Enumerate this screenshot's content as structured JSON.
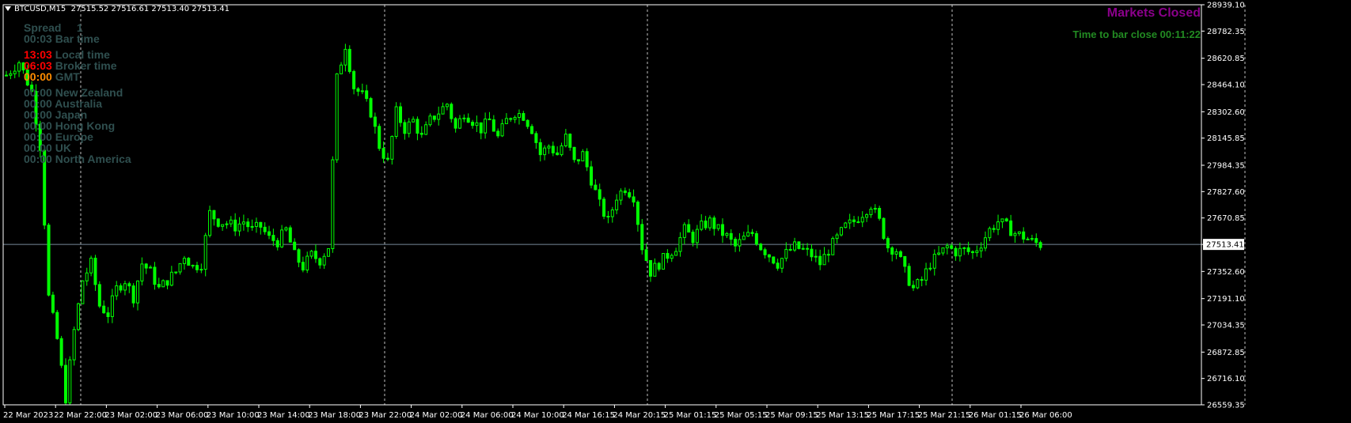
{
  "header": {
    "symbol": "BTCUSD,M15",
    "ohlc": "27515.52 27516.61 27513.40 27513.41"
  },
  "status": {
    "markets": "Markets Closed",
    "bar_close": "Time to bar close 00:11:22"
  },
  "info_panel": {
    "spread_label": "Spread",
    "spread_value": "1",
    "bar_time_value": "00:03",
    "bar_time_label": "Bar time",
    "local_time_value": "13:03",
    "local_time_label": "Local time",
    "broker_time_value": "06:03",
    "broker_time_label": "Broker time",
    "gmt_value": "00:00",
    "gmt_label": "GMT",
    "sessions": [
      {
        "time": "00:00",
        "name": "New Zealand"
      },
      {
        "time": "00:00",
        "name": "Australia"
      },
      {
        "time": "00:00",
        "name": "Japan"
      },
      {
        "time": "00:00",
        "name": "Hong Kong"
      },
      {
        "time": "00:00",
        "name": "Europe"
      },
      {
        "time": "00:00",
        "name": "UK"
      },
      {
        "time": "00:00",
        "name": "North America"
      }
    ]
  },
  "colors": {
    "background": "#000000",
    "candles": "#00ff00",
    "grid_separator": "#c0c0c0",
    "bid_line": "#778899",
    "panel_text": "#2f4f4f",
    "local_time": "#ff0000",
    "broker_time": "#ff0000",
    "gmt": "#ff8c00",
    "markets_closed": "#8b008b",
    "bar_close": "#228b22"
  },
  "chart_data": {
    "type": "candlestick",
    "symbol": "BTCUSD",
    "timeframe": "M15",
    "current_price": 27513.41,
    "ylim": [
      26559.35,
      28939.1
    ],
    "y_ticks": [
      "28939.10",
      "28782.35",
      "28620.85",
      "28464.10",
      "28302.60",
      "28145.85",
      "27984.35",
      "27827.60",
      "27670.85",
      "27513.41",
      "27352.60",
      "27191.10",
      "27034.35",
      "26872.85",
      "26716.10",
      "26559.35"
    ],
    "x_ticks": [
      "22 Mar 2023",
      "22 Mar 22:00",
      "23 Mar 02:00",
      "23 Mar 06:00",
      "23 Mar 10:00",
      "23 Mar 14:00",
      "23 Mar 18:00",
      "23 Mar 22:00",
      "24 Mar 02:00",
      "24 Mar 06:00",
      "24 Mar 10:00",
      "24 Mar 16:15",
      "24 Mar 20:15",
      "25 Mar 01:15",
      "25 Mar 05:15",
      "25 Mar 09:15",
      "25 Mar 13:15",
      "25 Mar 17:15",
      "25 Mar 21:15",
      "26 Mar 01:15",
      "26 Mar 06:00"
    ],
    "day_separators_at_ticks": [
      1,
      7,
      12,
      18
    ],
    "close_path": [
      [
        0,
        28520
      ],
      [
        3,
        28600
      ],
      [
        6,
        28420
      ],
      [
        8,
        28100
      ],
      [
        10,
        27200
      ],
      [
        12,
        26950
      ],
      [
        14,
        26600
      ],
      [
        16,
        27000
      ],
      [
        18,
        27300
      ],
      [
        20,
        27400
      ],
      [
        22,
        27150
      ],
      [
        24,
        27100
      ],
      [
        26,
        27250
      ],
      [
        28,
        27300
      ],
      [
        30,
        27200
      ],
      [
        32,
        27400
      ],
      [
        34,
        27350
      ],
      [
        36,
        27250
      ],
      [
        38,
        27300
      ],
      [
        40,
        27350
      ],
      [
        42,
        27450
      ],
      [
        44,
        27380
      ],
      [
        46,
        27400
      ],
      [
        48,
        27700
      ],
      [
        50,
        27650
      ],
      [
        52,
        27640
      ],
      [
        54,
        27620
      ],
      [
        56,
        27650
      ],
      [
        58,
        27600
      ],
      [
        60,
        27620
      ],
      [
        62,
        27550
      ],
      [
        64,
        27530
      ],
      [
        66,
        27600
      ],
      [
        68,
        27450
      ],
      [
        70,
        27380
      ],
      [
        72,
        27450
      ],
      [
        74,
        27420
      ],
      [
        76,
        27500
      ],
      [
        78,
        28500
      ],
      [
        80,
        28700
      ],
      [
        82,
        28450
      ],
      [
        84,
        28400
      ],
      [
        86,
        28300
      ],
      [
        88,
        28100
      ],
      [
        90,
        28000
      ],
      [
        92,
        28300
      ],
      [
        94,
        28200
      ],
      [
        96,
        28250
      ],
      [
        98,
        28150
      ],
      [
        100,
        28250
      ],
      [
        102,
        28300
      ],
      [
        104,
        28350
      ],
      [
        106,
        28200
      ],
      [
        108,
        28300
      ],
      [
        110,
        28250
      ],
      [
        112,
        28200
      ],
      [
        114,
        28250
      ],
      [
        116,
        28150
      ],
      [
        118,
        28250
      ],
      [
        120,
        28300
      ],
      [
        122,
        28280
      ],
      [
        124,
        28200
      ],
      [
        126,
        28050
      ],
      [
        128,
        28100
      ],
      [
        130,
        28050
      ],
      [
        132,
        28150
      ],
      [
        134,
        28000
      ],
      [
        136,
        28050
      ],
      [
        138,
        27900
      ],
      [
        140,
        27750
      ],
      [
        142,
        27650
      ],
      [
        144,
        27800
      ],
      [
        146,
        27850
      ],
      [
        148,
        27800
      ],
      [
        150,
        27500
      ],
      [
        152,
        27350
      ],
      [
        154,
        27400
      ],
      [
        156,
        27450
      ],
      [
        158,
        27500
      ],
      [
        160,
        27600
      ],
      [
        162,
        27550
      ],
      [
        164,
        27620
      ],
      [
        166,
        27650
      ],
      [
        168,
        27600
      ],
      [
        170,
        27560
      ],
      [
        172,
        27500
      ],
      [
        174,
        27550
      ],
      [
        176,
        27580
      ],
      [
        178,
        27500
      ],
      [
        180,
        27450
      ],
      [
        182,
        27400
      ],
      [
        184,
        27460
      ],
      [
        186,
        27500
      ],
      [
        188,
        27480
      ],
      [
        190,
        27450
      ],
      [
        192,
        27400
      ],
      [
        194,
        27480
      ],
      [
        196,
        27550
      ],
      [
        198,
        27620
      ],
      [
        200,
        27650
      ],
      [
        202,
        27700
      ],
      [
        204,
        27750
      ],
      [
        206,
        27650
      ],
      [
        208,
        27500
      ],
      [
        210,
        27480
      ],
      [
        212,
        27350
      ],
      [
        214,
        27250
      ],
      [
        216,
        27300
      ],
      [
        218,
        27400
      ],
      [
        220,
        27450
      ],
      [
        222,
        27500
      ],
      [
        224,
        27470
      ],
      [
        226,
        27480
      ],
      [
        228,
        27460
      ],
      [
        230,
        27520
      ],
      [
        232,
        27600
      ],
      [
        234,
        27650
      ],
      [
        236,
        27620
      ],
      [
        238,
        27580
      ],
      [
        240,
        27560
      ],
      [
        242,
        27530
      ],
      [
        244,
        27513.41
      ]
    ]
  }
}
